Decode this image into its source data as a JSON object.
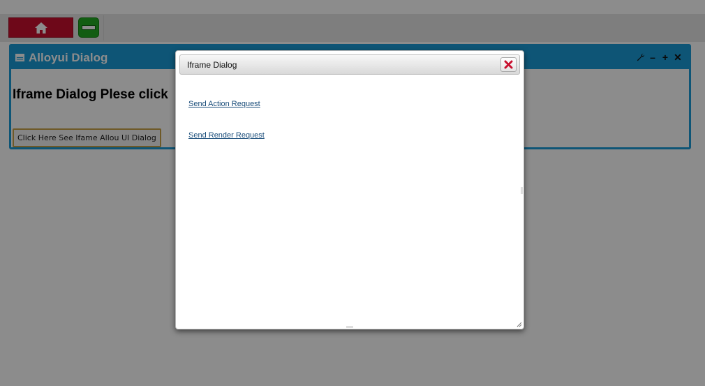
{
  "toolbar": {
    "home_icon": "home-icon",
    "toggle_icon": "minus-icon"
  },
  "portlet": {
    "title": "Alloyui Dialog",
    "title_icon": "window-icon",
    "controls": [
      {
        "name": "configure",
        "glyph": "🔧"
      },
      {
        "name": "minimize",
        "glyph": "–"
      },
      {
        "name": "maximize",
        "glyph": "+"
      },
      {
        "name": "close",
        "glyph": "✕"
      }
    ],
    "heading": "Iframe Dialog Plese click",
    "button_label": "Click Here See Ifame Allou UI Dialog"
  },
  "dialog": {
    "title": "Iframe Dialog",
    "close_icon": "close-icon",
    "links": [
      {
        "label": "Send Action Request"
      },
      {
        "label": "Send Render Request"
      }
    ]
  },
  "colors": {
    "portlet_header": "#1a9bd7",
    "home_button": "#c8102e",
    "toggle_button": "#22aa22",
    "link": "#1a4d7a"
  }
}
